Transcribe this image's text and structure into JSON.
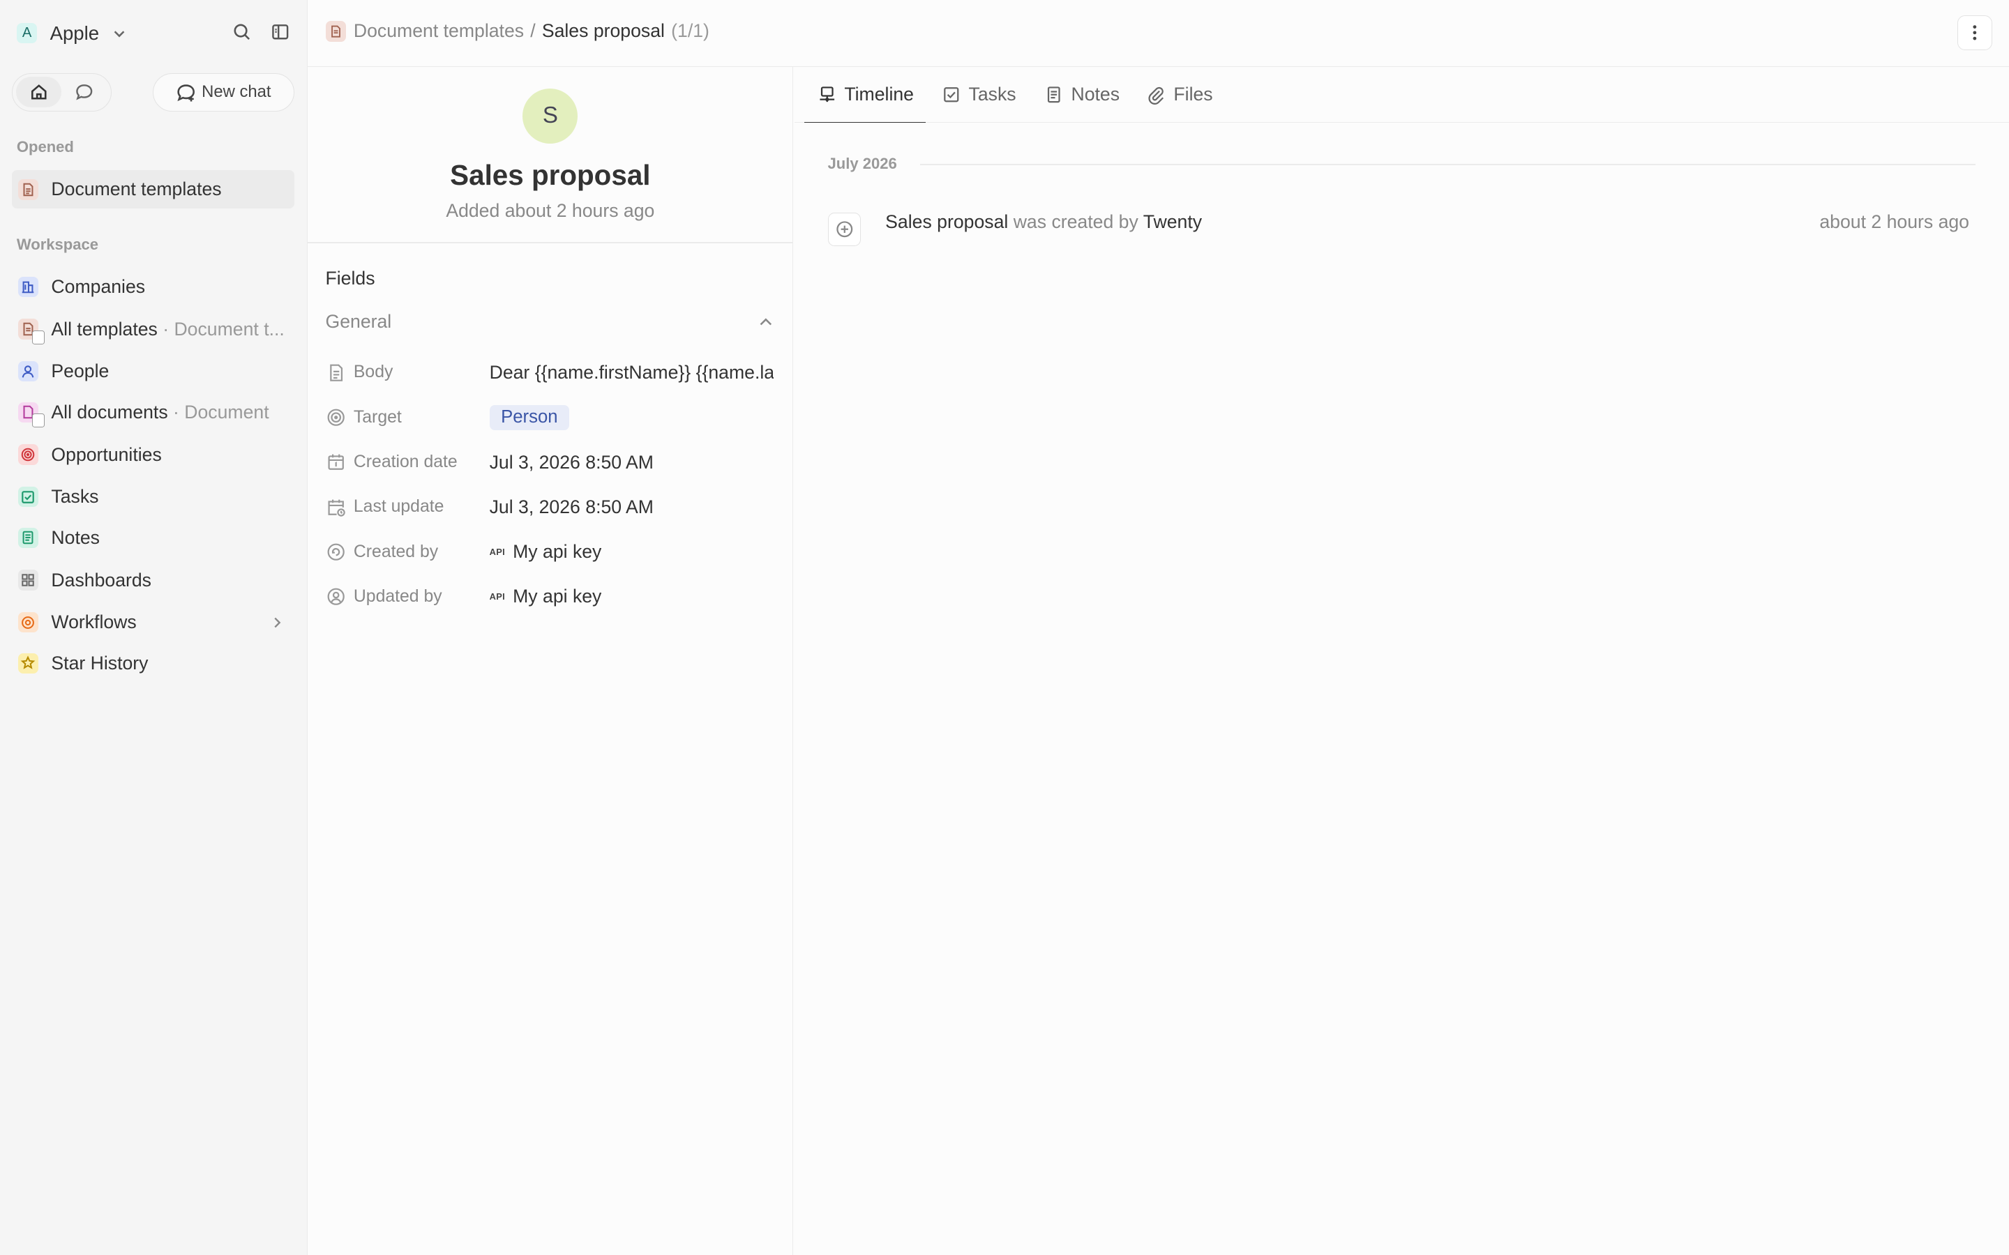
{
  "workspace": {
    "logo_letter": "A",
    "name": "Apple"
  },
  "sidebar": {
    "new_chat_label": "New chat",
    "opened_label": "Opened",
    "opened_item": "Document templates",
    "workspace_label": "Workspace",
    "items": [
      {
        "label": "Companies",
        "sub": ""
      },
      {
        "label": "All templates",
        "sub": "· Document t..."
      },
      {
        "label": "People",
        "sub": ""
      },
      {
        "label": "All documents",
        "sub": "· Document"
      },
      {
        "label": "Opportunities",
        "sub": ""
      },
      {
        "label": "Tasks",
        "sub": ""
      },
      {
        "label": "Notes",
        "sub": ""
      },
      {
        "label": "Dashboards",
        "sub": ""
      },
      {
        "label": "Workflows",
        "sub": ""
      },
      {
        "label": "Star History",
        "sub": ""
      }
    ]
  },
  "breadcrumb": {
    "parent": "Document templates",
    "separator": "/",
    "current": "Sales proposal",
    "count": "(1/1)"
  },
  "record": {
    "avatar_letter": "S",
    "title": "Sales proposal",
    "subtitle": "Added about 2 hours ago",
    "fields_title": "Fields",
    "group_label": "General",
    "fields": [
      {
        "key": "Body",
        "value": "Dear {{name.firstName}} {{name.lastName}},"
      },
      {
        "key": "Target",
        "value": "Person"
      },
      {
        "key": "Creation date",
        "value": "Jul 3, 2026 8:50 AM"
      },
      {
        "key": "Last update",
        "value": "Jul 3, 2026 8:50 AM"
      },
      {
        "key": "Created by",
        "value": "My api key"
      },
      {
        "key": "Updated by",
        "value": "My api key"
      }
    ],
    "api_tag": "API"
  },
  "tabs": [
    "Timeline",
    "Tasks",
    "Notes",
    "Files"
  ],
  "timeline": {
    "month": "July 2026",
    "event": {
      "subject": "Sales proposal",
      "verb": "was created by",
      "actor": "Twenty",
      "time": "about 2 hours ago"
    }
  },
  "colors": {
    "workspace_logo_bg": "#d9f5f2",
    "avatar_bg": "#e3efbe",
    "target_chip_bg": "#e8ecf8",
    "target_chip_text": "#3a55a6"
  }
}
